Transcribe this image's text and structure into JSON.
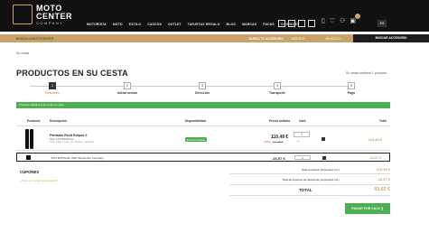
{
  "brand": {
    "line1": "MOTO",
    "line2": "CENTER",
    "line3": "COMPANY"
  },
  "nav": [
    "MOTORISTA",
    "MOTO",
    "ESTILO",
    "CASCOS",
    "OUTLET",
    "TARJETAS REGALO",
    "BLOG",
    "MARCAS",
    "PACKS",
    "CONTACTO"
  ],
  "header": {
    "cart_count": "0",
    "lang": "ES"
  },
  "search": {
    "placeholder": "BUSCA LA MOTOCENTER",
    "tab_accessory": "BUSCA TU ACCESORIO",
    "tab_model": "MODELO",
    "tab_vehicle": "VEHÍCULO",
    "button": "BUSCAR ACCESORIO"
  },
  "breadcrumb": "Su cesta",
  "page_title": "PRODUCTOS EN SU CESTA",
  "cart_count_text": "Su cesta contiene 1 producto",
  "steps": [
    {
      "num": "1",
      "label": "Resumen"
    },
    {
      "num": "2",
      "label": "Iniciar sesión"
    },
    {
      "num": "3",
      "label": "Dirección"
    },
    {
      "num": "4",
      "label": "Transporte"
    },
    {
      "num": "5",
      "label": "Pago"
    }
  ],
  "alert": "Producto añadido a la cesta con éxito",
  "table_headers": {
    "product": "Producto",
    "description": "Descripción",
    "availability": "Disponibilidad",
    "unit_price": "Precio unitario",
    "qty": "Cant.",
    "total": "Total"
  },
  "item": {
    "name": "Pantalón Revit Eclipse 2",
    "sku": "REF: FPT082305412",
    "attrs": "Talla : Negro, Talla : XL, Medida : Standard",
    "availability": "Envío inmediato",
    "price": "110,49 €",
    "discount": "-10%",
    "old_price": "122,99 €",
    "qty": "1",
    "qty_stepper": "- +",
    "total": "110,49 €"
  },
  "promo_line": {
    "name": "-15% EXTRA En Web Motocenter Company",
    "price": "-16,57 €",
    "qty": "1",
    "total": "-16,57 €"
  },
  "coupons": {
    "title": "CUPONES",
    "link": "¿Tiene un código promocional?"
  },
  "summary": {
    "products_label": "Total productos (impuestos inc.)",
    "products_value": "110,49 €",
    "discount_label": "Total de cupones de descuento (impuestos inc.)",
    "discount_value": "-16,57 €",
    "total_label": "TOTAL",
    "total_value": "93,92 €"
  },
  "pay_button": "PAGAR POR CAJA",
  "colors": {
    "accent": "#c9a36a",
    "success": "#4caf50",
    "dark": "#111111"
  }
}
